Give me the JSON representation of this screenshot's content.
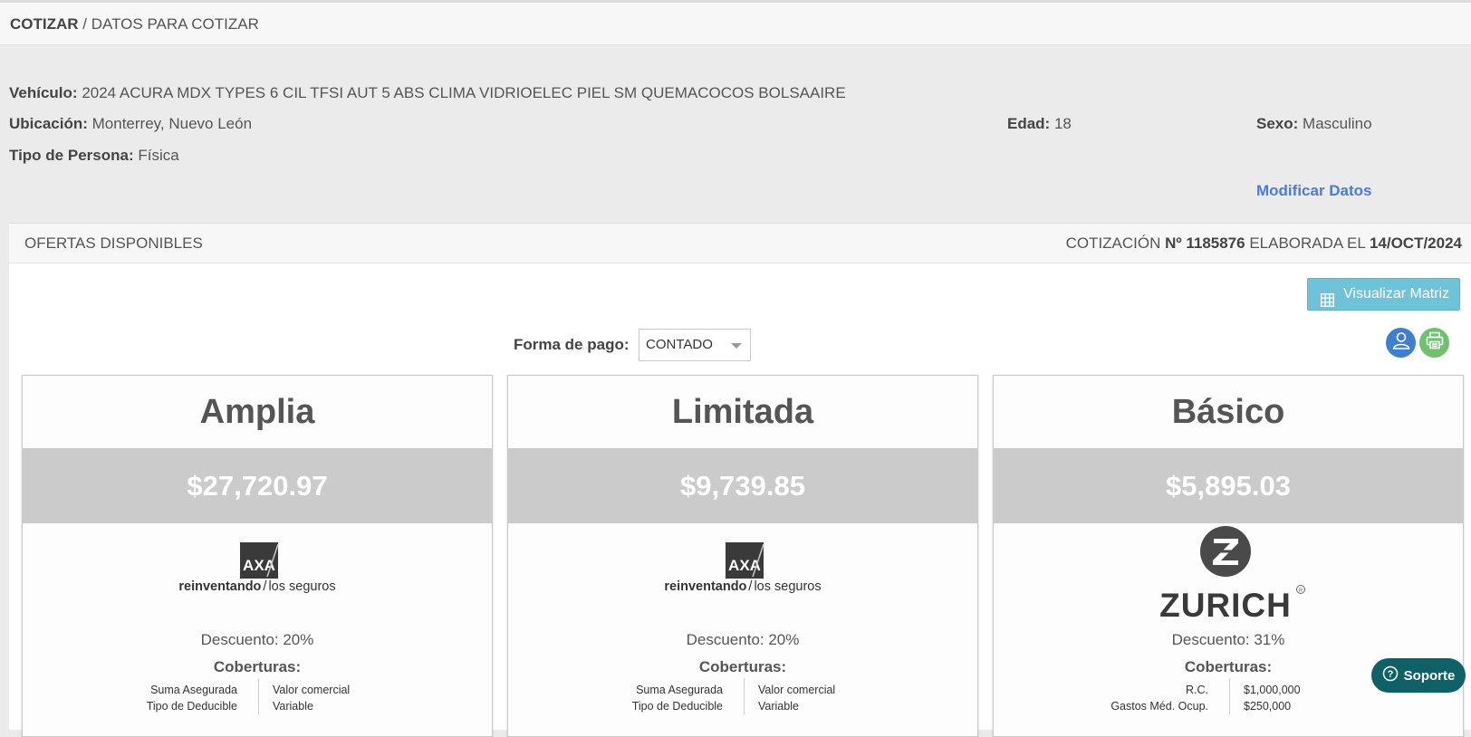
{
  "breadcrumb": {
    "root": "COTIZAR",
    "separator": "/",
    "current": "DATOS PARA COTIZAR"
  },
  "details": {
    "vehicle_label": "Vehículo:",
    "vehicle_value": "2024 ACURA MDX TYPES 6 CIL TFSI AUT 5 ABS CLIMA VIDRIOELEC PIEL SM QUEMACOCOS BOLSAAIRE",
    "location_label": "Ubicación:",
    "location_value": "Monterrey, Nuevo León",
    "age_label": "Edad:",
    "age_value": "18",
    "sex_label": "Sexo:",
    "sex_value": "Masculino",
    "person_type_label": "Tipo de Persona:",
    "person_type_value": "Física",
    "modify_link": "Modificar Datos"
  },
  "offers": {
    "title": "OFERTAS DISPONIBLES",
    "quote_prefix": "COTIZACIÓN",
    "quote_number": "Nº 1185876",
    "quote_mid": "ELABORADA EL",
    "quote_date": "14/OCT/2024",
    "matrix_button": "Visualizar Matriz",
    "payment_label": "Forma de pago:",
    "payment_value": "CONTADO",
    "cards": [
      {
        "title": "Amplia",
        "price": "$27,720.97",
        "insurer_logo_text": "AXA",
        "tagline_bold": "reinventando",
        "tagline_rest": "los seguros",
        "discount": "Descuento: 20%",
        "coverage_title": "Coberturas:",
        "coverages": [
          {
            "label": "Suma Asegurada",
            "value": "Valor comercial"
          },
          {
            "label": "Tipo de Deducible",
            "value": "Variable"
          }
        ]
      },
      {
        "title": "Limitada",
        "price": "$9,739.85",
        "insurer_logo_text": "AXA",
        "tagline_bold": "reinventando",
        "tagline_rest": "los seguros",
        "discount": "Descuento: 20%",
        "coverage_title": "Coberturas:",
        "coverages": [
          {
            "label": "Suma Asegurada",
            "value": "Valor comercial"
          },
          {
            "label": "Tipo de Deducible",
            "value": "Variable"
          }
        ]
      },
      {
        "title": "Básico",
        "price": "$5,895.03",
        "insurer_logo_text": "ZURICH",
        "discount": "Descuento: 31%",
        "coverage_title": "Coberturas:",
        "coverages": [
          {
            "label": "R.C.",
            "value": "$1,000,000"
          },
          {
            "label": "Gastos Méd. Ocup.",
            "value": "$250,000"
          }
        ]
      }
    ]
  },
  "support_button": "Soporte",
  "colors": {
    "link": "#4a7cd6",
    "matrix_button": "#6ec3d9",
    "user_button": "#3f7fcf",
    "print_button": "#6dc26b",
    "support": "#0f6168",
    "price_band": "#cbcbcb"
  },
  "icons": {
    "matrix": "grid-icon",
    "user": "user-icon",
    "print": "printer-icon",
    "support": "question-icon",
    "select": "chevron-down-icon"
  }
}
